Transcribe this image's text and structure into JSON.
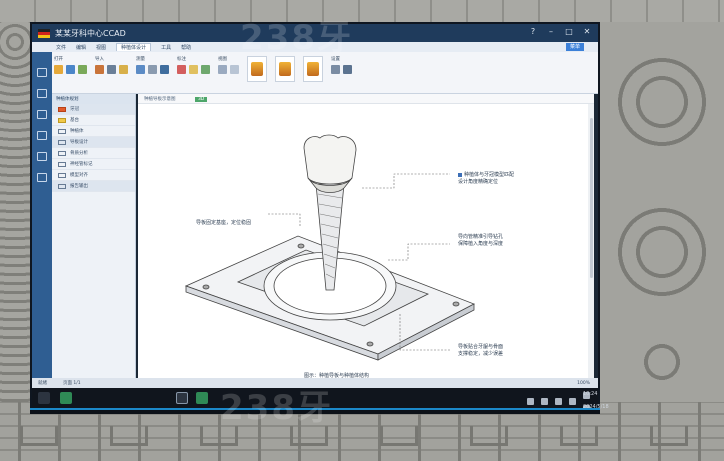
{
  "window": {
    "title": "某某牙科中心CCAD"
  },
  "tabs": [
    {
      "label": "文件"
    },
    {
      "label": "编辑"
    },
    {
      "label": "视图"
    },
    {
      "label": "种植体设计",
      "active": true
    },
    {
      "label": "工具"
    },
    {
      "label": "帮助"
    }
  ],
  "menu_button": "菜单",
  "ribbon_groups": [
    {
      "label": "打开"
    },
    {
      "label": "导入"
    },
    {
      "label": "测量"
    },
    {
      "label": "标注"
    },
    {
      "label": "视图"
    },
    {
      "label": "设置"
    }
  ],
  "nav": {
    "header": "种植体规划",
    "items": [
      {
        "label": "牙冠"
      },
      {
        "label": "基台"
      },
      {
        "label": "种植体"
      },
      {
        "label": "导板设计"
      },
      {
        "label": "骨质分析"
      },
      {
        "label": "神经管标记"
      },
      {
        "label": "模型对齐"
      },
      {
        "label": "报告输出"
      }
    ]
  },
  "canvas": {
    "tab_label": "种植导板示意图",
    "badge": "3D"
  },
  "callouts": {
    "top_right": "种植体与牙冠模型匹配\n设计角度精确定位",
    "left": "导板固定基座，定位稳固",
    "mid_right": "导向管精准引导钻孔\n保障植入角度与深度",
    "bottom_right": "导板贴合牙龈与骨面\n支撑稳定，减少误差"
  },
  "caption": "图示：种植导板与种植体结构",
  "status": {
    "left": "就绪",
    "middle": "页面 1/1",
    "zoom": "100%"
  },
  "clock": {
    "time": "10:24",
    "date": "2024/5/18"
  },
  "colors": {
    "accent": "#1f3b5c",
    "ribbon_highlight": "#3b80d8",
    "badge_green": "#4da66a"
  },
  "watermark": "238牙"
}
